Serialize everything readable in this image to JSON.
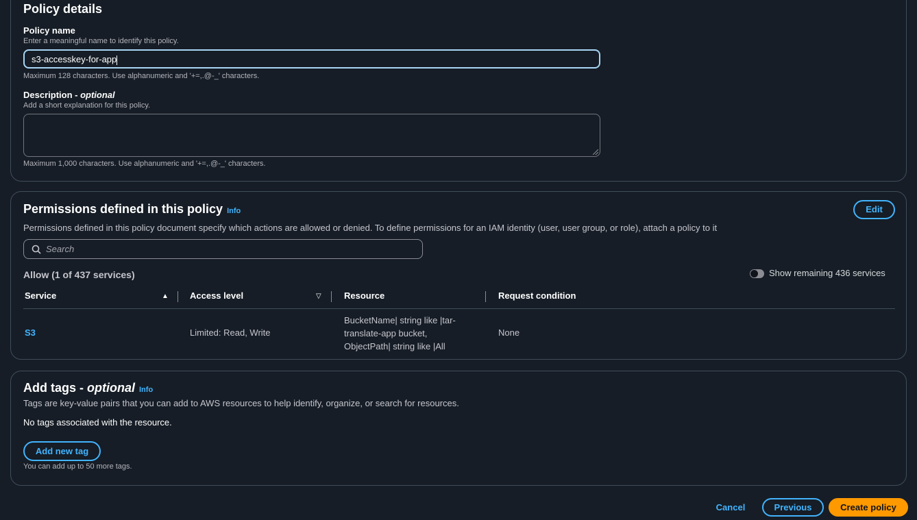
{
  "policy_details": {
    "title": "Policy details",
    "name_label": "Policy name",
    "name_description": "Enter a meaningful name to identify this policy.",
    "name_value": "s3-accesskey-for-app",
    "name_constraint": "Maximum 128 characters. Use alphanumeric and '+=,.@-_' characters.",
    "description_label": "Description - ",
    "description_optional": "optional",
    "description_description": "Add a short explanation for this policy.",
    "description_value": "",
    "description_constraint": "Maximum 1,000 characters. Use alphanumeric and '+=,.@-_' characters."
  },
  "permissions": {
    "title": "Permissions defined in this policy",
    "info": "Info",
    "edit_label": "Edit",
    "description": "Permissions defined in this policy document specify which actions are allowed or denied. To define permissions for an IAM identity (user, user group, or role), attach a policy to it",
    "search_placeholder": "Search",
    "allow_heading": "Allow (1 of 437 services)",
    "toggle_label": "Show remaining 436 services",
    "toggle_on": false,
    "columns": [
      "Service",
      "Access level",
      "Resource",
      "Request condition"
    ],
    "rows": [
      {
        "service": "S3",
        "access_level": "Limited: Read, Write",
        "resource_lines": [
          "BucketName| string like |tar-",
          "translate-app bucket,",
          "ObjectPath| string like |All"
        ],
        "request_condition": "None"
      }
    ]
  },
  "tags": {
    "title": "Add tags - ",
    "title_optional": "optional",
    "info": "Info",
    "description": "Tags are key-value pairs that you can add to AWS resources to help identify, organize, or search for resources.",
    "empty_message": "No tags associated with the resource.",
    "add_button": "Add new tag",
    "limit_text": "You can add up to 50 more tags."
  },
  "footer": {
    "cancel": "Cancel",
    "previous": "Previous",
    "create": "Create policy"
  },
  "colors": {
    "accent": "#42b4ff",
    "primary": "#ff9900",
    "background": "#161d26"
  }
}
